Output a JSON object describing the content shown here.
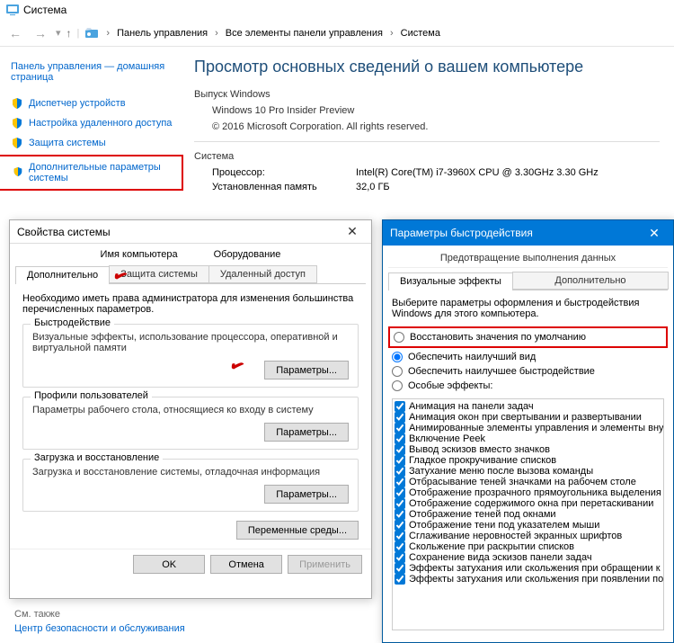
{
  "system_window": {
    "title": "Система",
    "breadcrumb": [
      "Панель управления",
      "Все элементы панели управления",
      "Система"
    ],
    "sidebar": {
      "home": "Панель управления — домашняя страница",
      "links": [
        "Диспетчер устройств",
        "Настройка удаленного доступа",
        "Защита системы",
        "Дополнительные параметры системы"
      ],
      "see_also_label": "См. также",
      "see_also": "Центр безопасности и обслуживания"
    },
    "main": {
      "heading": "Просмотр основных сведений о вашем компьютере",
      "edition_label": "Выпуск Windows",
      "edition": "Windows 10 Pro Insider Preview",
      "copyright": "© 2016 Microsoft Corporation. All rights reserved.",
      "system_label": "Система",
      "cpu_label": "Процессор:",
      "cpu_value": "Intel(R) Core(TM) i7-3960X CPU @ 3.30GHz   3.30 GHz",
      "ram_label": "Установленная память",
      "ram_value": "32,0 ГБ"
    }
  },
  "props_dialog": {
    "title": "Свойства системы",
    "tabs_row1": [
      "Имя компьютера",
      "Оборудование"
    ],
    "tabs_row2": [
      "Дополнительно",
      "Защита системы",
      "Удаленный доступ"
    ],
    "intro": "Необходимо иметь права администратора для изменения большинства перечисленных параметров.",
    "groups": [
      {
        "legend": "Быстродействие",
        "text": "Визуальные эффекты, использование процессора, оперативной и виртуальной памяти",
        "button": "Параметры..."
      },
      {
        "legend": "Профили пользователей",
        "text": "Параметры рабочего стола, относящиеся ко входу в систему",
        "button": "Параметры..."
      },
      {
        "legend": "Загрузка и восстановление",
        "text": "Загрузка и восстановление системы, отладочная информация",
        "button": "Параметры..."
      }
    ],
    "env_button": "Переменные среды...",
    "ok": "OK",
    "cancel": "Отмена",
    "apply": "Применить"
  },
  "perf_dialog": {
    "title": "Параметры быстродействия",
    "dep_tab": "Предотвращение выполнения данных",
    "tabs": [
      "Визуальные эффекты",
      "Дополнительно"
    ],
    "intro": "Выберите параметры оформления и быстродействия Windows для этого компьютера.",
    "radios": [
      "Восстановить значения по умолчанию",
      "Обеспечить наилучший вид",
      "Обеспечить наилучшее быстродействие",
      "Особые эффекты:"
    ],
    "checks": [
      "Анимация на панели задач",
      "Анимация окон при свертывании и развертывании",
      "Анимированные элементы управления и элементы внут",
      "Включение Peek",
      "Вывод эскизов вместо значков",
      "Гладкое прокручивание списков",
      "Затухание меню после вызова команды",
      "Отбрасывание теней значками на рабочем столе",
      "Отображение прозрачного прямоугольника выделения",
      "Отображение содержимого окна при перетаскивании",
      "Отображение теней под окнами",
      "Отображение тени под указателем мыши",
      "Сглаживание неровностей экранных шрифтов",
      "Скольжение при раскрытии списков",
      "Сохранение вида эскизов панели задач",
      "Эффекты затухания или скольжения при обращении к м",
      "Эффекты затухания или скольжения при появлении по"
    ]
  }
}
